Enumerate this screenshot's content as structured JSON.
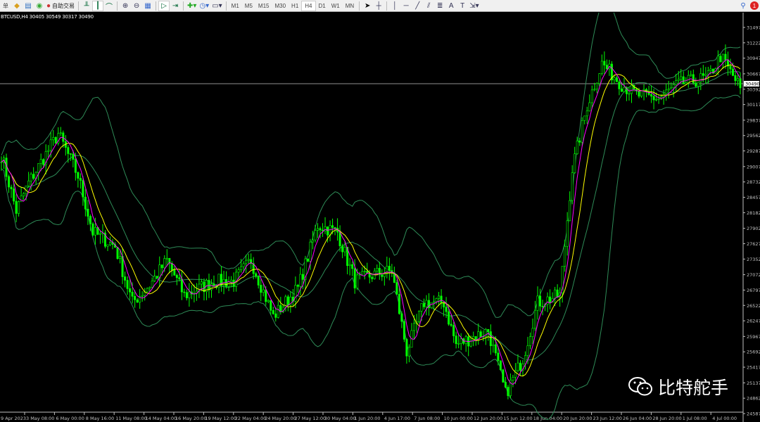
{
  "toolbar": {
    "left_items": [
      {
        "icon": "menu-label",
        "label": "单"
      },
      {
        "icon": "folder-icon"
      },
      {
        "icon": "navigator-icon"
      },
      {
        "icon": "signal-icon"
      },
      {
        "icon": "autotrade-icon",
        "label": "自助交易"
      }
    ],
    "timeframes": [
      "M1",
      "M5",
      "M15",
      "M30",
      "H1",
      "H4",
      "D1",
      "W1",
      "MN"
    ],
    "active_timeframe": "H4",
    "notification_count": "1"
  },
  "symbol_info": "BTCUSD,H4  30405 30549 30317 30490",
  "current_price": "30490",
  "price_axis": [
    "31497",
    "31222",
    "30947",
    "30667",
    "30392",
    "30117",
    "29837",
    "29562",
    "29287",
    "29007",
    "28732",
    "28457",
    "28182",
    "27902",
    "27627",
    "27352",
    "27072",
    "26797",
    "26522",
    "26247",
    "25967",
    "25692",
    "25417",
    "25137",
    "24862",
    "24587"
  ],
  "time_axis": [
    "9 Apr 2023",
    "3 May 08:00",
    "6 May 00:00",
    "8 May 16:00",
    "11 May 08:00",
    "14 May 04:00",
    "16 May 20:00",
    "19 May 12:00",
    "22 May 04:00",
    "24 May 20:00",
    "27 May 12:00",
    "30 May 04:00",
    "1 Jun 20:00",
    "4 Jun 17:00",
    "7 Jun 08:00",
    "10 Jun 00:00",
    "12 Jun 20:00",
    "15 Jun 12:00",
    "18 Jun 04:00",
    "20 Jun 20:00",
    "23 Jun 12:00",
    "26 Jun 04:00",
    "28 Jun 20:00",
    "1 Jul 08:00",
    "4 Jul 00:00"
  ],
  "watermark": "比特舵手",
  "colors": {
    "candle": "#00ff00",
    "ma_fast": "#ff00ff",
    "ma_slow": "#ffff00",
    "bands": "#2e8b57",
    "price_line": "#c0c0c0"
  },
  "chart_data": {
    "type": "candlestick",
    "symbol": "BTCUSD",
    "timeframe": "H4",
    "ylim": [
      24587,
      31497
    ],
    "bars": 300,
    "close_anchors": [
      [
        0,
        29219
      ],
      [
        6,
        28212
      ],
      [
        11,
        28715
      ],
      [
        23,
        29596
      ],
      [
        31,
        28840
      ],
      [
        37,
        27834
      ],
      [
        46,
        27583
      ],
      [
        53,
        26575
      ],
      [
        60,
        26890
      ],
      [
        67,
        27331
      ],
      [
        74,
        26700
      ],
      [
        86,
        26953
      ],
      [
        94,
        26953
      ],
      [
        101,
        27331
      ],
      [
        110,
        26324
      ],
      [
        120,
        26827
      ],
      [
        128,
        27960
      ],
      [
        136,
        27834
      ],
      [
        143,
        26953
      ],
      [
        151,
        27080
      ],
      [
        158,
        27142
      ],
      [
        164,
        25695
      ],
      [
        171,
        26575
      ],
      [
        179,
        26575
      ],
      [
        184,
        25820
      ],
      [
        197,
        26072
      ],
      [
        204,
        24940
      ],
      [
        211,
        25568
      ],
      [
        217,
        26575
      ],
      [
        226,
        26700
      ],
      [
        231,
        28966
      ],
      [
        237,
        30100
      ],
      [
        243,
        30855
      ],
      [
        251,
        30478
      ],
      [
        257,
        30289
      ],
      [
        266,
        30226
      ],
      [
        274,
        30478
      ],
      [
        286,
        30604
      ],
      [
        291,
        30981
      ],
      [
        299,
        30415
      ]
    ],
    "indicators": [
      "MA fast (magenta)",
      "MA slow (yellow)",
      "Bollinger Bands (green)"
    ]
  }
}
